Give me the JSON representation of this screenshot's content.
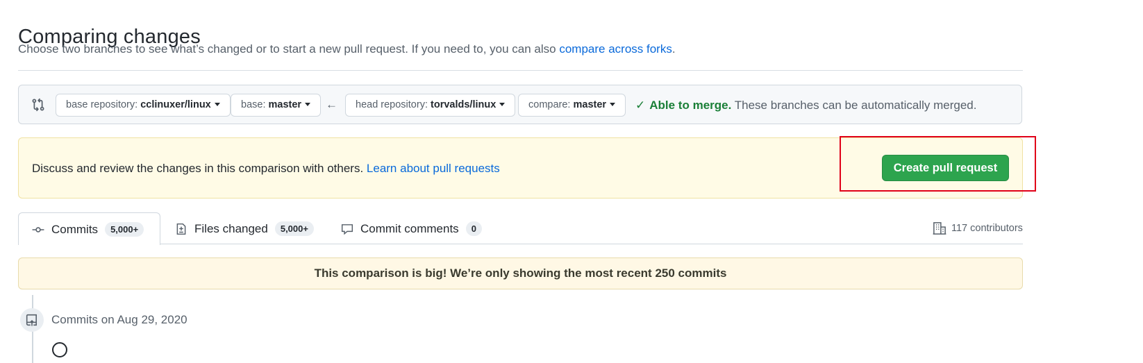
{
  "header": {
    "title": "Comparing changes",
    "subtitle": "Choose two branches to see what’s changed or to start a new pull request. If you need to, you can also",
    "subtitle_link": "compare across forks",
    "subtitle_end": "."
  },
  "range": {
    "compare_icon": "git-compare-icon",
    "base_repo_label": "base repository:",
    "base_repo_value": "cclinuxer/linux",
    "base_label": "base:",
    "base_value": "master",
    "arrow": "←",
    "head_repo_label": "head repository:",
    "head_repo_value": "torvalds/linux",
    "compare_label": "compare:",
    "compare_value": "master",
    "merge_check": "✓",
    "merge_status": "Able to merge.",
    "merge_message": "These branches can be automatically merged."
  },
  "blankslate": {
    "text": "Discuss and review the changes in this comparison with others.",
    "link": "Learn about pull requests",
    "button": "Create pull request"
  },
  "tabs": [
    {
      "label": "Commits",
      "count": "5,000+",
      "icon": "commit-icon",
      "selected": true
    },
    {
      "label": "Files changed",
      "count": "5,000+",
      "icon": "file-diff-icon",
      "selected": false
    },
    {
      "label": "Commit comments",
      "count": "0",
      "icon": "comment-icon",
      "selected": false
    }
  ],
  "contributors": "117 contributors",
  "flash": "This comparison is big! We’re only showing the most recent 250 commits",
  "timeline": {
    "icon": "repo-push-icon",
    "date_heading": "Commits on Aug 29, 2020"
  },
  "colors": {
    "link": "#0969da",
    "success": "#1a7f37",
    "primary_button": "#2da44e",
    "highlight_box": "#e00018"
  }
}
